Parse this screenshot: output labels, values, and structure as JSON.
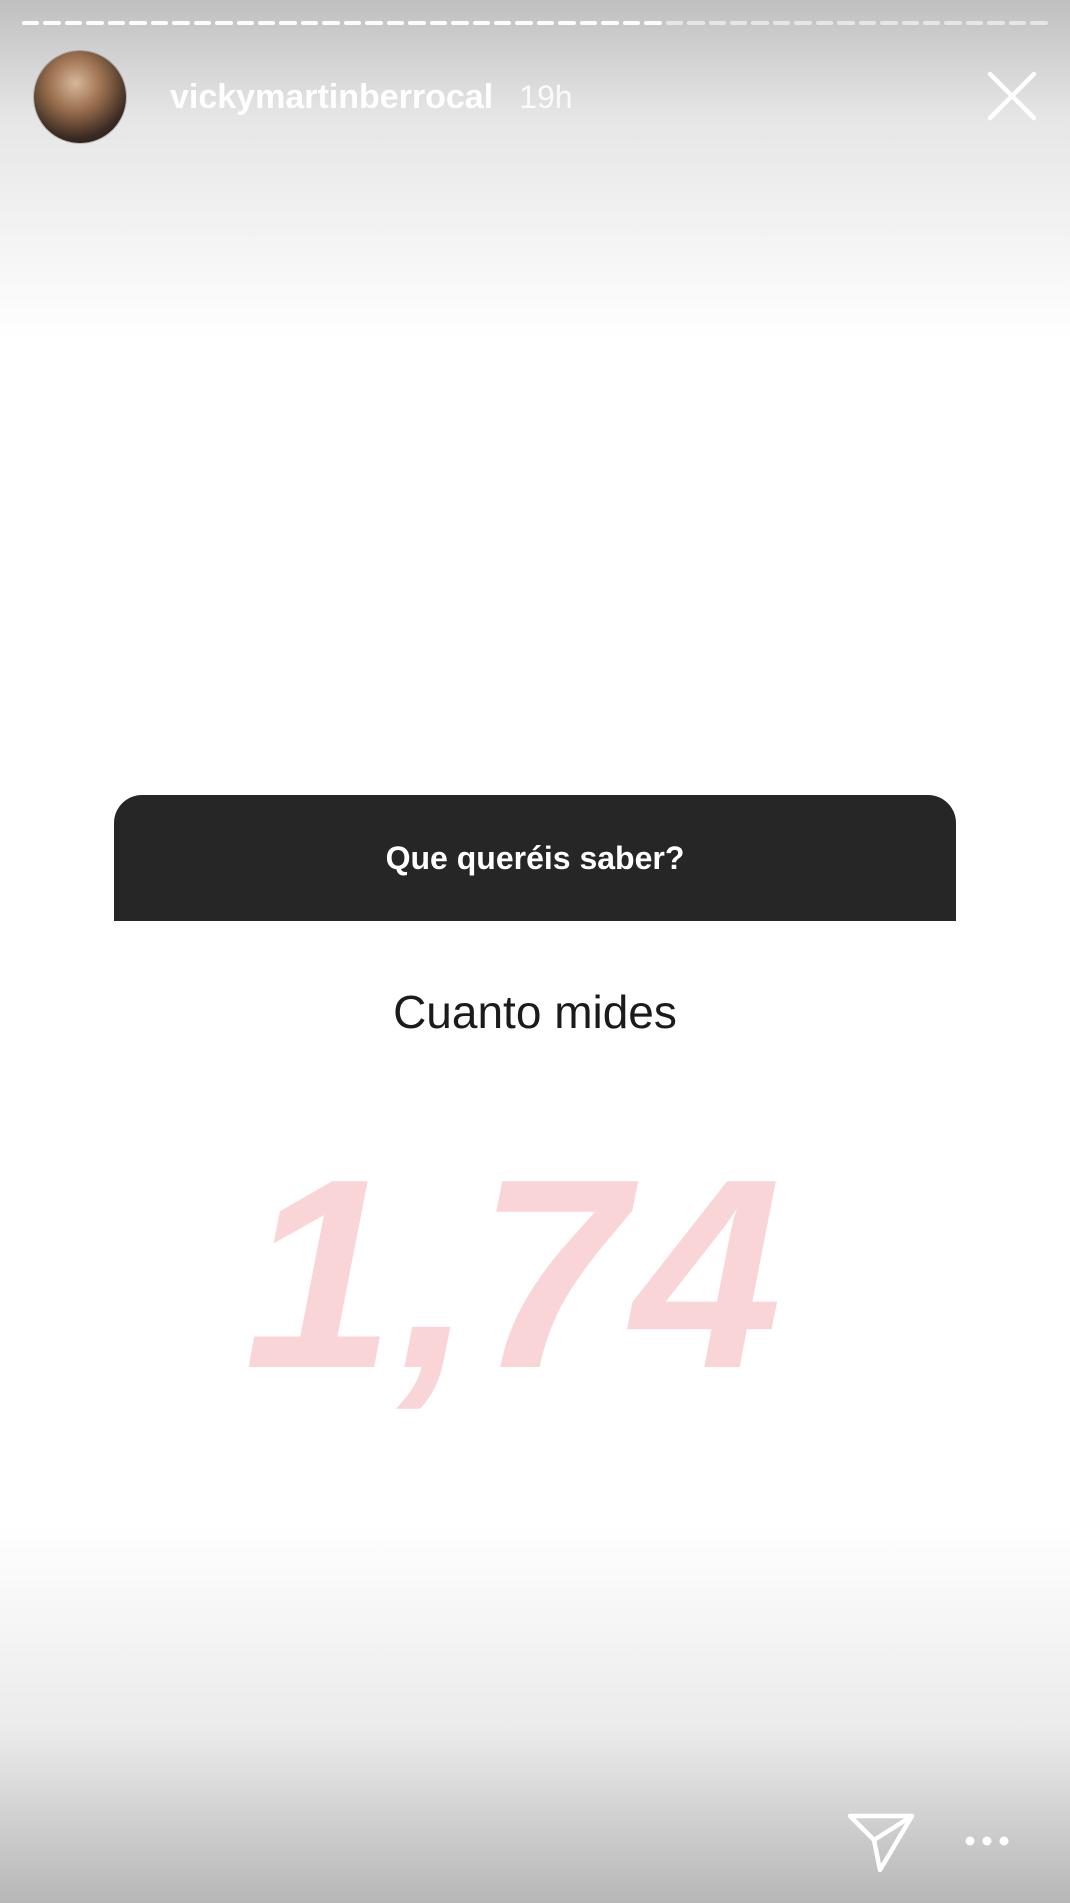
{
  "story": {
    "progress_segments_total": 48,
    "progress_segments_done": 30
  },
  "header": {
    "username": "vickymartinberrocal",
    "time_ago": "19h",
    "avatar_icon": "profile-photo",
    "close_icon": "close-x-icon"
  },
  "question_sticker": {
    "prompt": "Que queréis saber?",
    "card_color": "#262626"
  },
  "answer": {
    "question": "Cuanto mides",
    "value_text": "1,74",
    "value_color": "#fad5d7"
  },
  "footer": {
    "send_icon": "paper-plane-icon",
    "more_icon": "more-dots-icon"
  }
}
